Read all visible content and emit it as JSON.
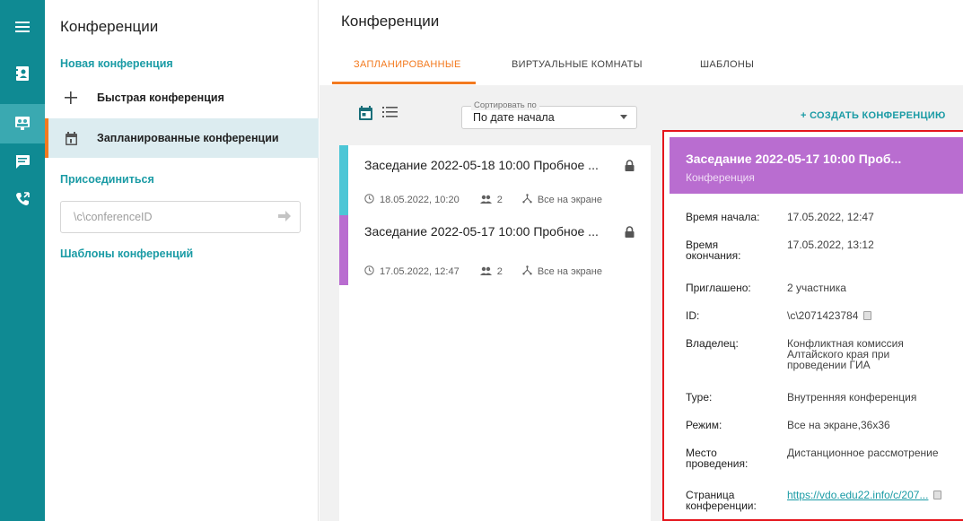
{
  "colors": {
    "rail": "#0f8a93",
    "accent": "#f37a1f",
    "link": "#1a9ba5",
    "cardA": "#4cc6d6",
    "cardB": "#b96dd0",
    "highlight": "#e5161d"
  },
  "rail": {
    "icons": [
      "menu-icon",
      "contacts-icon",
      "conference-icon",
      "chat-icon",
      "calls-icon"
    ]
  },
  "sidebar": {
    "title": "Конференции",
    "new_conference": "Новая конференция",
    "quick_conference": "Быстрая конференция",
    "scheduled_conferences": "Запланированные конференции",
    "join": "Присоединиться",
    "join_placeholder": "\\c\\conferenceID",
    "templates": "Шаблоны конференций"
  },
  "main": {
    "title": "Конференции",
    "tabs": [
      "ЗАПЛАНИРОВАННЫЕ",
      "ВИРТУАЛЬНЫЕ КОМНАТЫ",
      "ШАБЛОНЫ"
    ],
    "sort_caption": "Сортировать по",
    "sort_value": "По дате начала",
    "create_label": "+ СОЗДАТЬ КОНФЕРЕНЦИЮ"
  },
  "conferences": [
    {
      "title": "Заседание 2022-05-18 10:00 Пробное ...",
      "date": "18.05.2022, 10:20",
      "participants": "2",
      "mode": "Все на экране"
    },
    {
      "title": "Заседание 2022-05-17 10:00 Пробное ...",
      "date": "17.05.2022, 12:47",
      "participants": "2",
      "mode": "Все на экране"
    }
  ],
  "detail": {
    "title": "Заседание 2022-05-17 10:00 Проб...",
    "subtitle": "Конференция",
    "start_label": "Время начала:",
    "start_value": "17.05.2022, 12:47",
    "end_label_1": "Время",
    "end_label_2": "окончания:",
    "end_value": "17.05.2022, 13:12",
    "invited_label": "Приглашено:",
    "invited_value": "2 участника",
    "id_label": "ID:",
    "id_value": "\\c\\2071423784",
    "owner_label": "Владелец:",
    "owner_1": "Конфликтная комиссия",
    "owner_2": "Алтайского края при",
    "owner_3": "проведении ГИА",
    "type_label": "Type:",
    "type_value": "Внутренняя конференция",
    "mode_label": "Режим:",
    "mode_value": "Все на экране,36x36",
    "place_label_1": "Место",
    "place_label_2": "проведения:",
    "place_value": "Дистанционное рассмотрение",
    "page_label_1": "Страница",
    "page_label_2": "конференции:",
    "page_value": "https://vdo.edu22.info/c/207..."
  }
}
